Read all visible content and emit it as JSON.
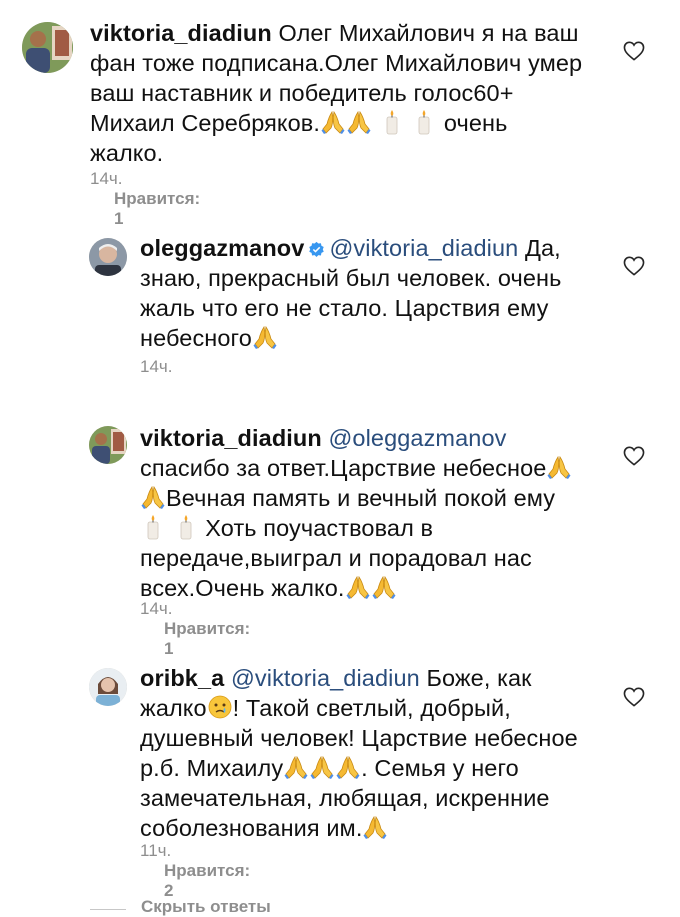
{
  "comments": [
    {
      "username": "viktoria_diadiun",
      "lines": [
        "Олег Михайлович я на ваш",
        "фан тоже подписана.Олег Михайлович умер",
        "ваш наставник и победитель голос60+",
        "Михаил Серебряков.",
        "очень",
        "жалко."
      ],
      "time": "14ч.",
      "likes": "Нравится: 1",
      "avatar": "avatar-photo"
    },
    {
      "username": "oleggazmanov",
      "verified": true,
      "mention": "@viktoria_diadiun",
      "lines": [
        "Да,",
        "знаю, прекрасный был человек. очень",
        "жаль что его не стало. Царствия ему",
        "небесного"
      ],
      "time": "14ч.",
      "avatar": "avatar-photo"
    },
    {
      "username": "viktoria_diadiun",
      "mention": "@oleggazmanov",
      "lines": [
        "спасибо за ответ.Царствие небесное",
        "Вечная память и вечный покой ему",
        "Хоть поучаствовал в",
        "передаче,выиграл и порадовал нас",
        "всех.Очень жалко."
      ],
      "time": "14ч.",
      "likes": "Нравится: 1",
      "avatar": "avatar-photo"
    },
    {
      "username": "oribk_a",
      "mention": "@viktoria_diadiun",
      "lines": [
        "Боже, как",
        "жалко",
        "! Такой светлый, добрый,",
        "душевный человек! Царствие небесное",
        "р.б. Михаилу",
        ". Семья у него",
        "замечательная, любящая, искренние",
        "соболезнования им."
      ],
      "time": "11ч.",
      "likes": "Нравится: 2",
      "avatar": "avatar-photo"
    }
  ],
  "hide_replies": "Скрыть ответы",
  "icons": {
    "like": "heart-outline-icon",
    "verified": "verified-badge-icon",
    "pray": "folded-hands-emoji",
    "candle": "candle-emoji",
    "cry": "crying-face-emoji"
  },
  "colors": {
    "text": "#111111",
    "meta": "#8e8e8e",
    "mention": "#2a4d7c",
    "verified": "#3897f0"
  }
}
